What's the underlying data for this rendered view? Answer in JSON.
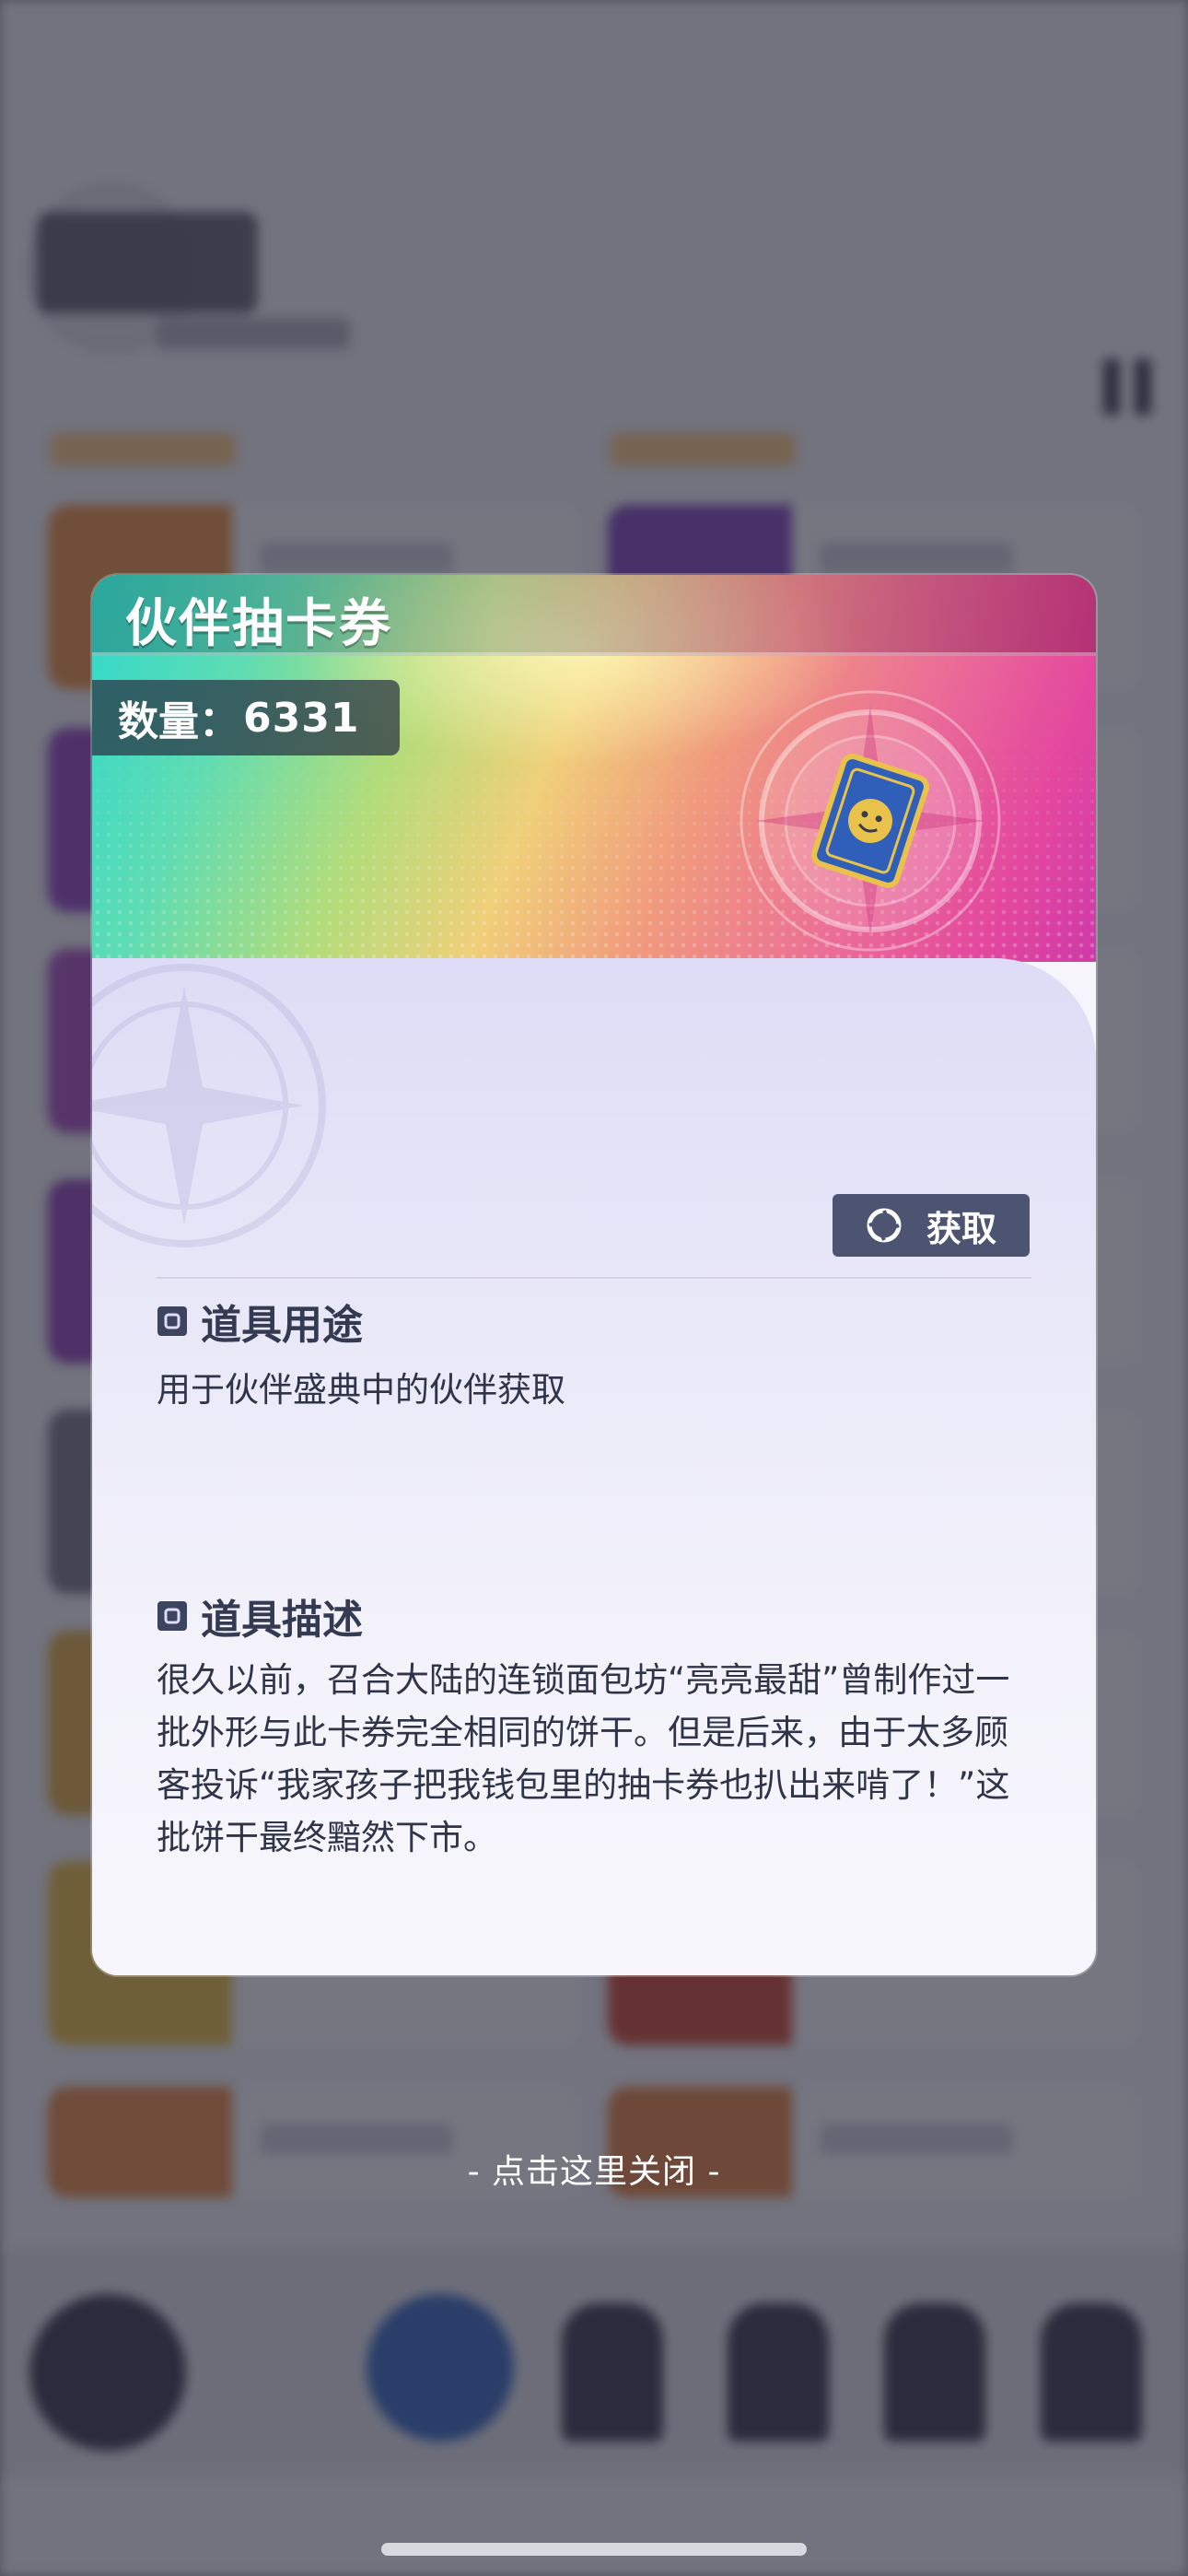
{
  "dialog": {
    "title": "伙伴抽卡券",
    "quantity_label": "数量：",
    "quantity_value": "6331",
    "get_button_label": "获取",
    "usage": {
      "heading": "道具用途",
      "text": "用于伙伴盛典中的伙伴获取"
    },
    "description": {
      "heading": "道具描述",
      "text": "很久以前，召合大陆的连锁面包坊“亮亮最甜”曾制作过一批外形与此卡券完全相同的饼干。但是后来，由于太多顾客投诉“我家孩子把我钱包里的抽卡券也扒出来啃了！”这批饼干最终黯然下市。"
    }
  },
  "close_hint": "- 点击这里关闭 -",
  "icons": {
    "card_ticket": "card-ticket-icon",
    "get": "aperture-icon",
    "section_marker": "square-bullet-icon",
    "pause": "pause-icon",
    "play": "play-icon"
  },
  "colors": {
    "button_bg": "#4c5472",
    "heading_text": "#343a52",
    "body_text": "#2f3449",
    "overlay": "rgba(40,42,56,0.62)",
    "card_blue": "#2f5fb8",
    "card_gold": "#e8c24a"
  }
}
